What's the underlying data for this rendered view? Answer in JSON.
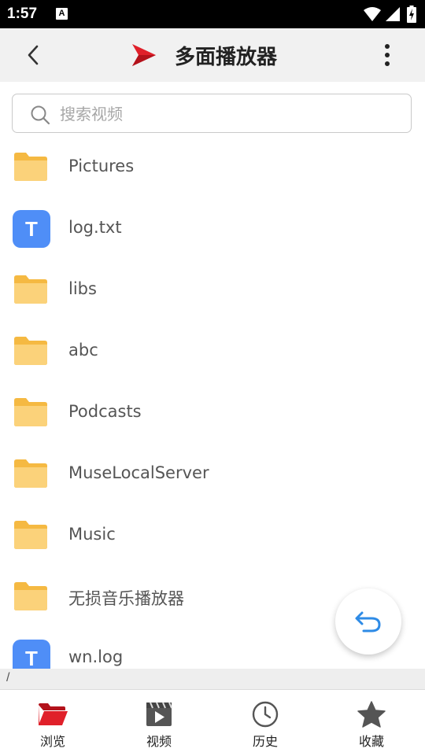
{
  "status_bar": {
    "time": "1:57",
    "notification_icon": "A"
  },
  "app_bar": {
    "title": "多面播放器",
    "back_icon": "back-arrow-icon",
    "menu_icon": "more-vert-icon",
    "logo_color": "#e0202a"
  },
  "search": {
    "placeholder": "搜索视频",
    "value": ""
  },
  "files": [
    {
      "name": "Pictures",
      "type": "folder"
    },
    {
      "name": "log.txt",
      "type": "text",
      "icon_letter": "T"
    },
    {
      "name": "libs",
      "type": "folder"
    },
    {
      "name": "abc",
      "type": "folder"
    },
    {
      "name": "Podcasts",
      "type": "folder"
    },
    {
      "name": "MuseLocalServer",
      "type": "folder"
    },
    {
      "name": "Music",
      "type": "folder"
    },
    {
      "name": "无损音乐播放器",
      "type": "folder"
    },
    {
      "name": "wn.log",
      "type": "text",
      "icon_letter": "T"
    }
  ],
  "path": "/",
  "fab": {
    "icon": "undo-icon",
    "color": "#2e8be6"
  },
  "bottom_nav": [
    {
      "label": "浏览",
      "icon": "folder-open-icon",
      "active": true
    },
    {
      "label": "视频",
      "icon": "video-icon",
      "active": false
    },
    {
      "label": "历史",
      "icon": "clock-icon",
      "active": false
    },
    {
      "label": "收藏",
      "icon": "star-icon",
      "active": false
    }
  ],
  "colors": {
    "accent": "#e0202a",
    "folder": "#f7c35b",
    "text_file": "#4f8ef7"
  }
}
